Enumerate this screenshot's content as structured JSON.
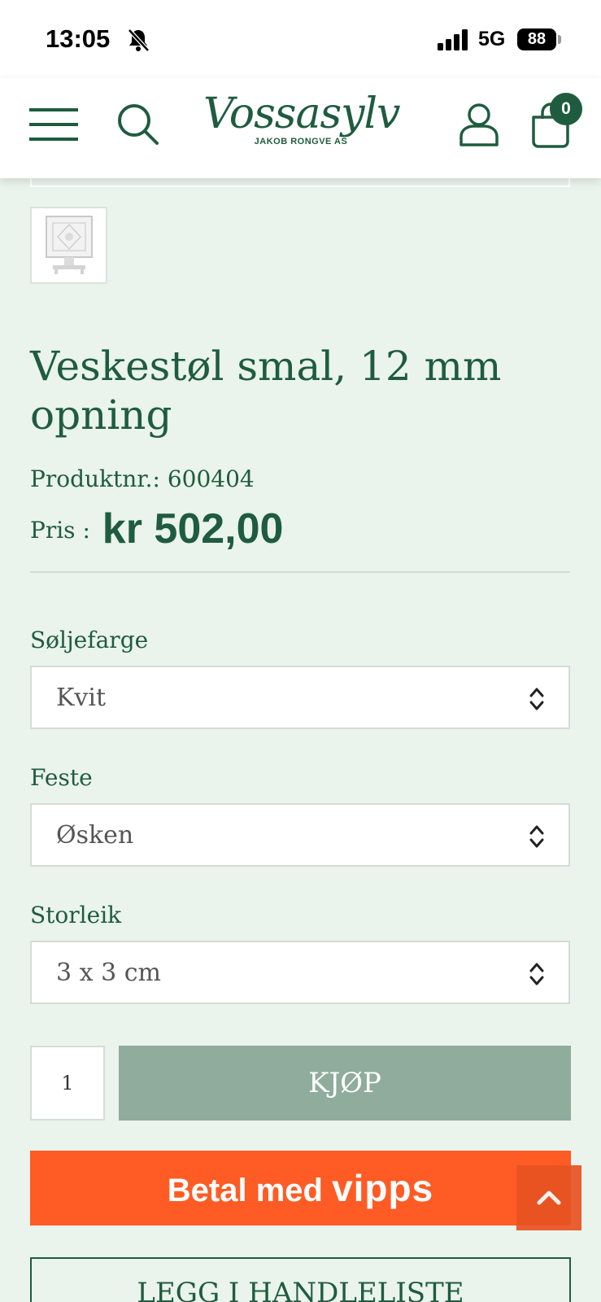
{
  "status_bar": {
    "time": "13:05",
    "network": "5G",
    "battery": "88"
  },
  "header": {
    "logo_text": "Vossasylv",
    "logo_subtext": "JAKOB RONGVE AS",
    "cart_count": "0"
  },
  "product": {
    "title": "Veskestøl smal, 12 mm opning",
    "sku_label": "Produktnr.:",
    "sku_value": "600404",
    "price_label": "Pris :",
    "price_value": "kr 502,00"
  },
  "options": [
    {
      "label": "Søljefarge",
      "value": "Kvit"
    },
    {
      "label": "Feste",
      "value": "Øsken"
    },
    {
      "label": "Storleik",
      "value": "3 x 3 cm"
    }
  ],
  "cart": {
    "quantity": "1",
    "buy_label": "KJØP",
    "vipps_label": "Betal med",
    "vipps_brand": "vipps",
    "wishlist_label": "LEGG I HANDLELISTE"
  },
  "colors": {
    "brand_green": "#1f5c3f",
    "page_bg": "#eaf3ec",
    "buy_button": "#8fac9d",
    "vipps_orange": "#ff5b24"
  },
  "icons": [
    "bell-off-icon",
    "signal-icon",
    "menu-icon",
    "search-icon",
    "user-icon",
    "cart-icon",
    "chevron-up-down-icon",
    "chevron-up-icon"
  ]
}
